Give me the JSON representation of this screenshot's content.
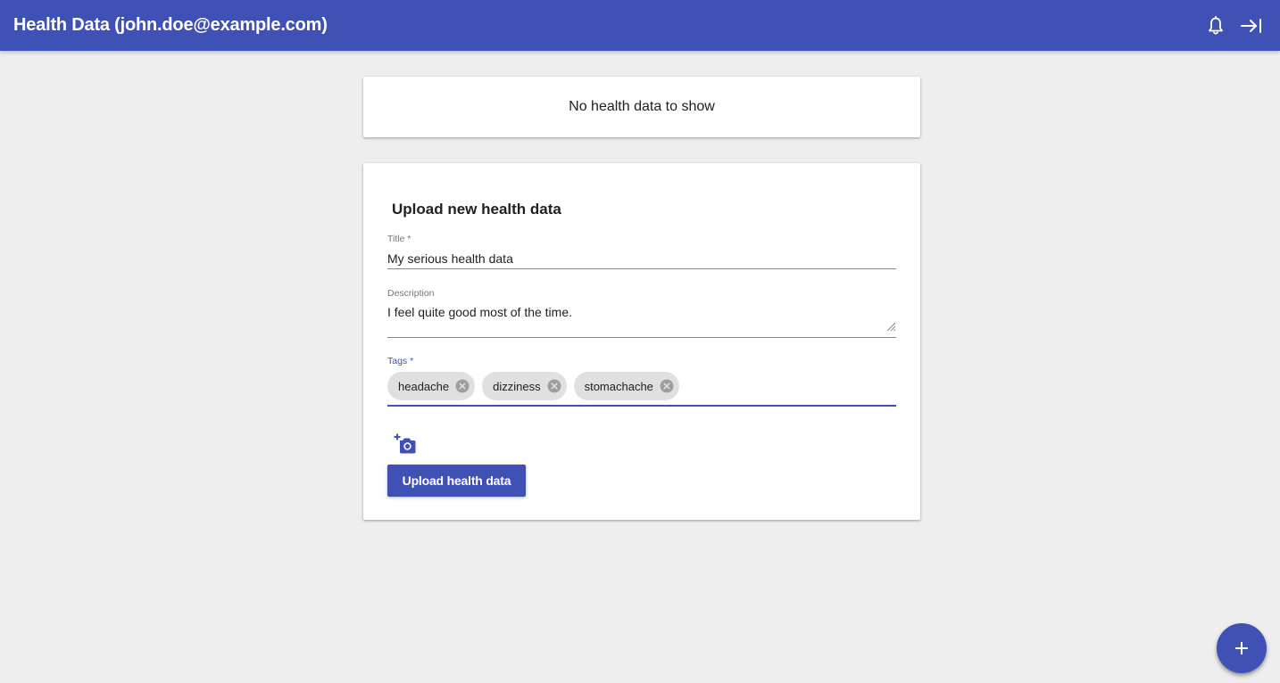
{
  "appbar": {
    "title": "Health Data (john.doe@example.com)",
    "icons": [
      "bell-icon",
      "logout-icon"
    ],
    "color": "#3f51b5"
  },
  "empty_card": {
    "message": "No health data to show"
  },
  "upload_form": {
    "heading": "Upload new health data",
    "title_field": {
      "label": "Title *",
      "value": "My serious health data"
    },
    "description_field": {
      "label": "Description",
      "value": "I feel quite good most of the time."
    },
    "tags_field": {
      "label": "Tags *",
      "chips": [
        {
          "label": "headache"
        },
        {
          "label": "dizziness"
        },
        {
          "label": "stomachache"
        }
      ]
    },
    "add_photo_icon": "add-a-photo-icon",
    "submit_label": "Upload health data"
  },
  "fab": {
    "icon": "plus-icon"
  }
}
